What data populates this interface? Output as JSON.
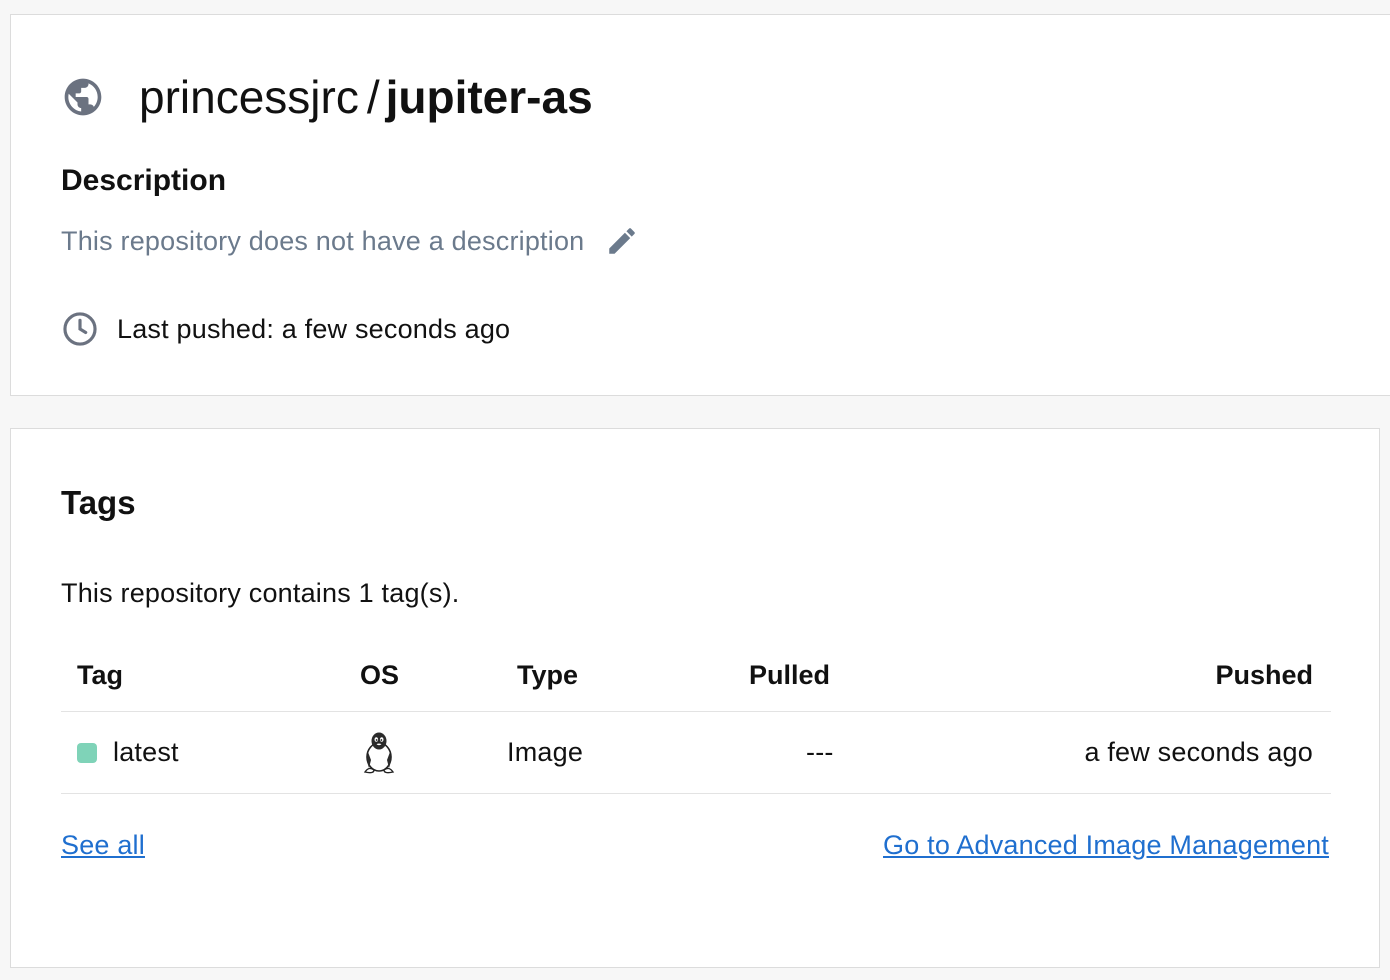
{
  "repo": {
    "namespace": "princessjrc",
    "separator": "/",
    "name": "jupiter-as",
    "visibility_icon": "globe-icon"
  },
  "description": {
    "heading": "Description",
    "text": "This repository does not have a description",
    "edit_icon": "pencil-icon"
  },
  "last_pushed": {
    "icon": "clock-icon",
    "text": "Last pushed: a few seconds ago"
  },
  "tags": {
    "heading": "Tags",
    "summary": "This repository contains 1 tag(s).",
    "columns": {
      "tag": "Tag",
      "os": "OS",
      "type": "Type",
      "pulled": "Pulled",
      "pushed": "Pushed"
    },
    "rows": [
      {
        "tag": "latest",
        "status_color": "#7fd3b8",
        "os_icon": "linux-tux-icon",
        "type": "Image",
        "pulled": "---",
        "pushed": "a few seconds ago"
      }
    ],
    "see_all": "See all",
    "advanced_link": "Go to Advanced Image Management"
  },
  "colors": {
    "link": "#1f6fcf",
    "muted": "#6b7a8c",
    "icon_gray": "#6b7280",
    "tag_status": "#7fd3b8"
  }
}
